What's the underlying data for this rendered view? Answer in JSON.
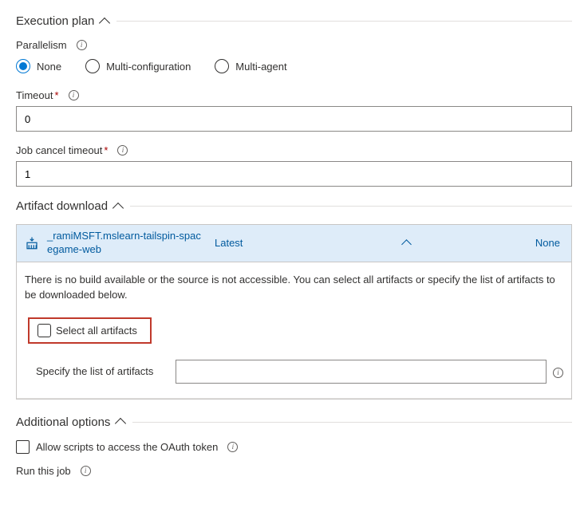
{
  "execution_plan": {
    "title": "Execution plan",
    "parallelism_label": "Parallelism",
    "radios": {
      "none": "None",
      "multi_config": "Multi-configuration",
      "multi_agent": "Multi-agent",
      "selected": "none"
    },
    "timeout_label": "Timeout",
    "timeout_value": "0",
    "cancel_label": "Job cancel timeout",
    "cancel_value": "1"
  },
  "artifact_download": {
    "title": "Artifact download",
    "source_name": "_ramiMSFT.mslearn-tailspin-spacegame-web",
    "latest_label": "Latest",
    "none_label": "None",
    "message": "There is no build available or the source is not accessible. You can select all artifacts or specify the list of artifacts to be downloaded below.",
    "select_all_label": "Select all artifacts",
    "specify_label": "Specify the list of artifacts",
    "specify_value": ""
  },
  "additional_options": {
    "title": "Additional options",
    "oauth_label": "Allow scripts to access the OAuth token",
    "run_job_label": "Run this job"
  }
}
